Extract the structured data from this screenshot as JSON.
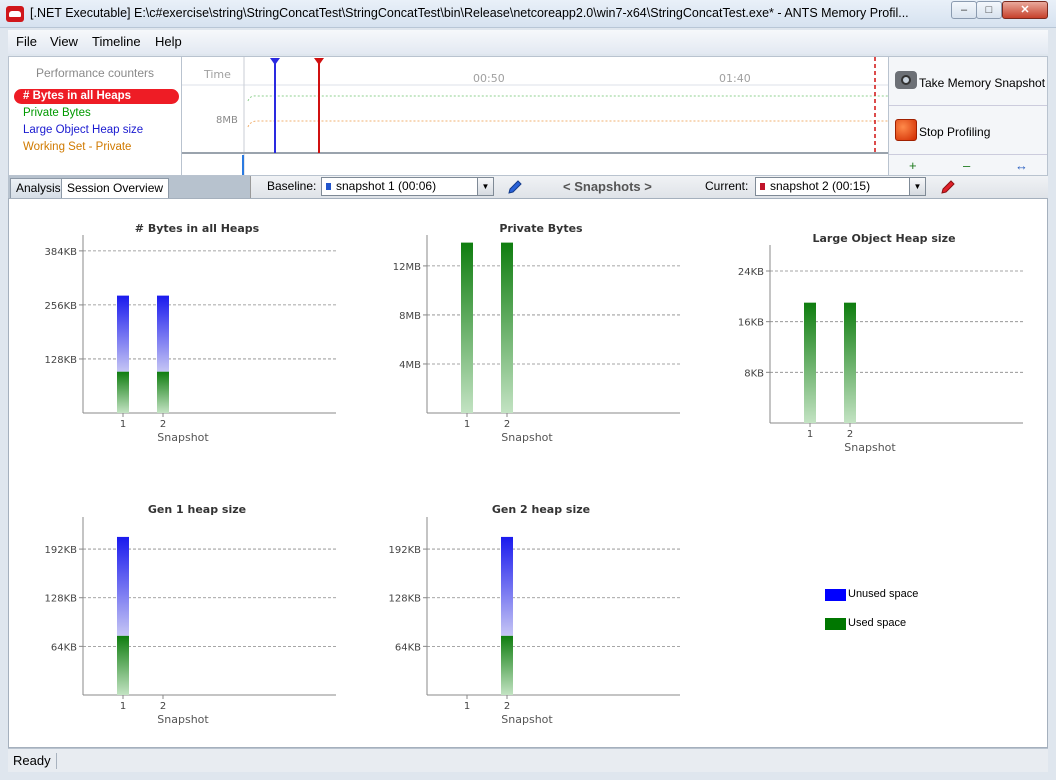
{
  "window": {
    "title": "[.NET Executable] E:\\c#exercise\\string\\StringConcatTest\\StringConcatTest\\bin\\Release\\netcoreapp2.0\\win7-x64\\StringConcatTest.exe* - ANTS Memory Profil...",
    "minimize_glyph": "–",
    "maximize_glyph": "□",
    "close_glyph": "✕"
  },
  "menu": {
    "file": "File",
    "view": "View",
    "timeline": "Timeline",
    "help": "Help"
  },
  "counters": {
    "header": "Performance counters",
    "items": [
      {
        "label": "# Bytes in all Heaps",
        "color": "#ee1c25",
        "selected": true
      },
      {
        "label": "Private Bytes",
        "color": "#009900"
      },
      {
        "label": "Large Object Heap size",
        "color": "#1a1ad0"
      },
      {
        "label": "Working Set - Private",
        "color": "#d07a00"
      }
    ]
  },
  "timeline": {
    "time_label": "Time",
    "mark1": "00:50",
    "mark2": "01:40",
    "y_label": "8MB"
  },
  "actions": {
    "take_snapshot": "Take Memory Snapshot",
    "stop_profiling": "Stop Profiling",
    "zoom_in_glyph": "+",
    "zoom_out_glyph": "–",
    "fit_glyph": "↔"
  },
  "tabs": {
    "analysis": "Analysis",
    "session_overview": "Session Overview"
  },
  "snapbar": {
    "baseline_label": "Baseline:",
    "baseline_value": "snapshot 1 (00:06)",
    "nav_label": "< Snapshots >",
    "current_label": "Current:",
    "current_value": "snapshot 2 (00:15)",
    "dropdown_glyph": "▼"
  },
  "legend": {
    "unused": "Unused space",
    "used": "Used space",
    "unused_color": "#0000ff",
    "used_color": "#007700"
  },
  "status": {
    "text": "Ready"
  },
  "chart_data": [
    {
      "type": "bar",
      "title": "# Bytes in all Heaps",
      "xlabel": "Snapshot",
      "categories": [
        "1",
        "2"
      ],
      "ylim": [
        0,
        450
      ],
      "ticks": [
        128,
        256,
        384
      ],
      "tick_labels": [
        "128KB",
        "256KB",
        "384KB"
      ],
      "series": [
        {
          "name": "Used space",
          "values": [
            98,
            98
          ]
        },
        {
          "name": "Unused space",
          "values": [
            180,
            180
          ]
        }
      ]
    },
    {
      "type": "bar",
      "title": "Private Bytes",
      "xlabel": "Snapshot",
      "categories": [
        "1",
        "2"
      ],
      "ylim": [
        0,
        15.5
      ],
      "ticks": [
        4,
        8,
        12
      ],
      "tick_labels": [
        "4MB",
        "8MB",
        "12MB"
      ],
      "series": [
        {
          "name": "Used space",
          "values": [
            13.9,
            13.9
          ]
        }
      ]
    },
    {
      "type": "bar",
      "title": "Large Object Heap size",
      "xlabel": "Snapshot",
      "categories": [
        "1",
        "2"
      ],
      "ylim": [
        0,
        30
      ],
      "ticks": [
        8,
        16,
        24
      ],
      "tick_labels": [
        "8KB",
        "16KB",
        "24KB"
      ],
      "series": [
        {
          "name": "Used space",
          "values": [
            19,
            19
          ]
        }
      ]
    },
    {
      "type": "bar",
      "title": "Gen 1 heap size",
      "xlabel": "Snapshot",
      "categories": [
        "1",
        "2"
      ],
      "ylim": [
        0,
        250
      ],
      "ticks": [
        64,
        128,
        192
      ],
      "tick_labels": [
        "64KB",
        "128KB",
        "192KB"
      ],
      "series": [
        {
          "name": "Used space",
          "values": [
            78,
            0
          ]
        },
        {
          "name": "Unused space",
          "values": [
            130,
            0
          ]
        }
      ]
    },
    {
      "type": "bar",
      "title": "Gen 2 heap size",
      "xlabel": "Snapshot",
      "categories": [
        "1",
        "2"
      ],
      "ylim": [
        0,
        250
      ],
      "ticks": [
        64,
        128,
        192
      ],
      "tick_labels": [
        "64KB",
        "128KB",
        "192KB"
      ],
      "series": [
        {
          "name": "Used space",
          "values": [
            0,
            78
          ]
        },
        {
          "name": "Unused space",
          "values": [
            0,
            130
          ]
        }
      ]
    }
  ]
}
